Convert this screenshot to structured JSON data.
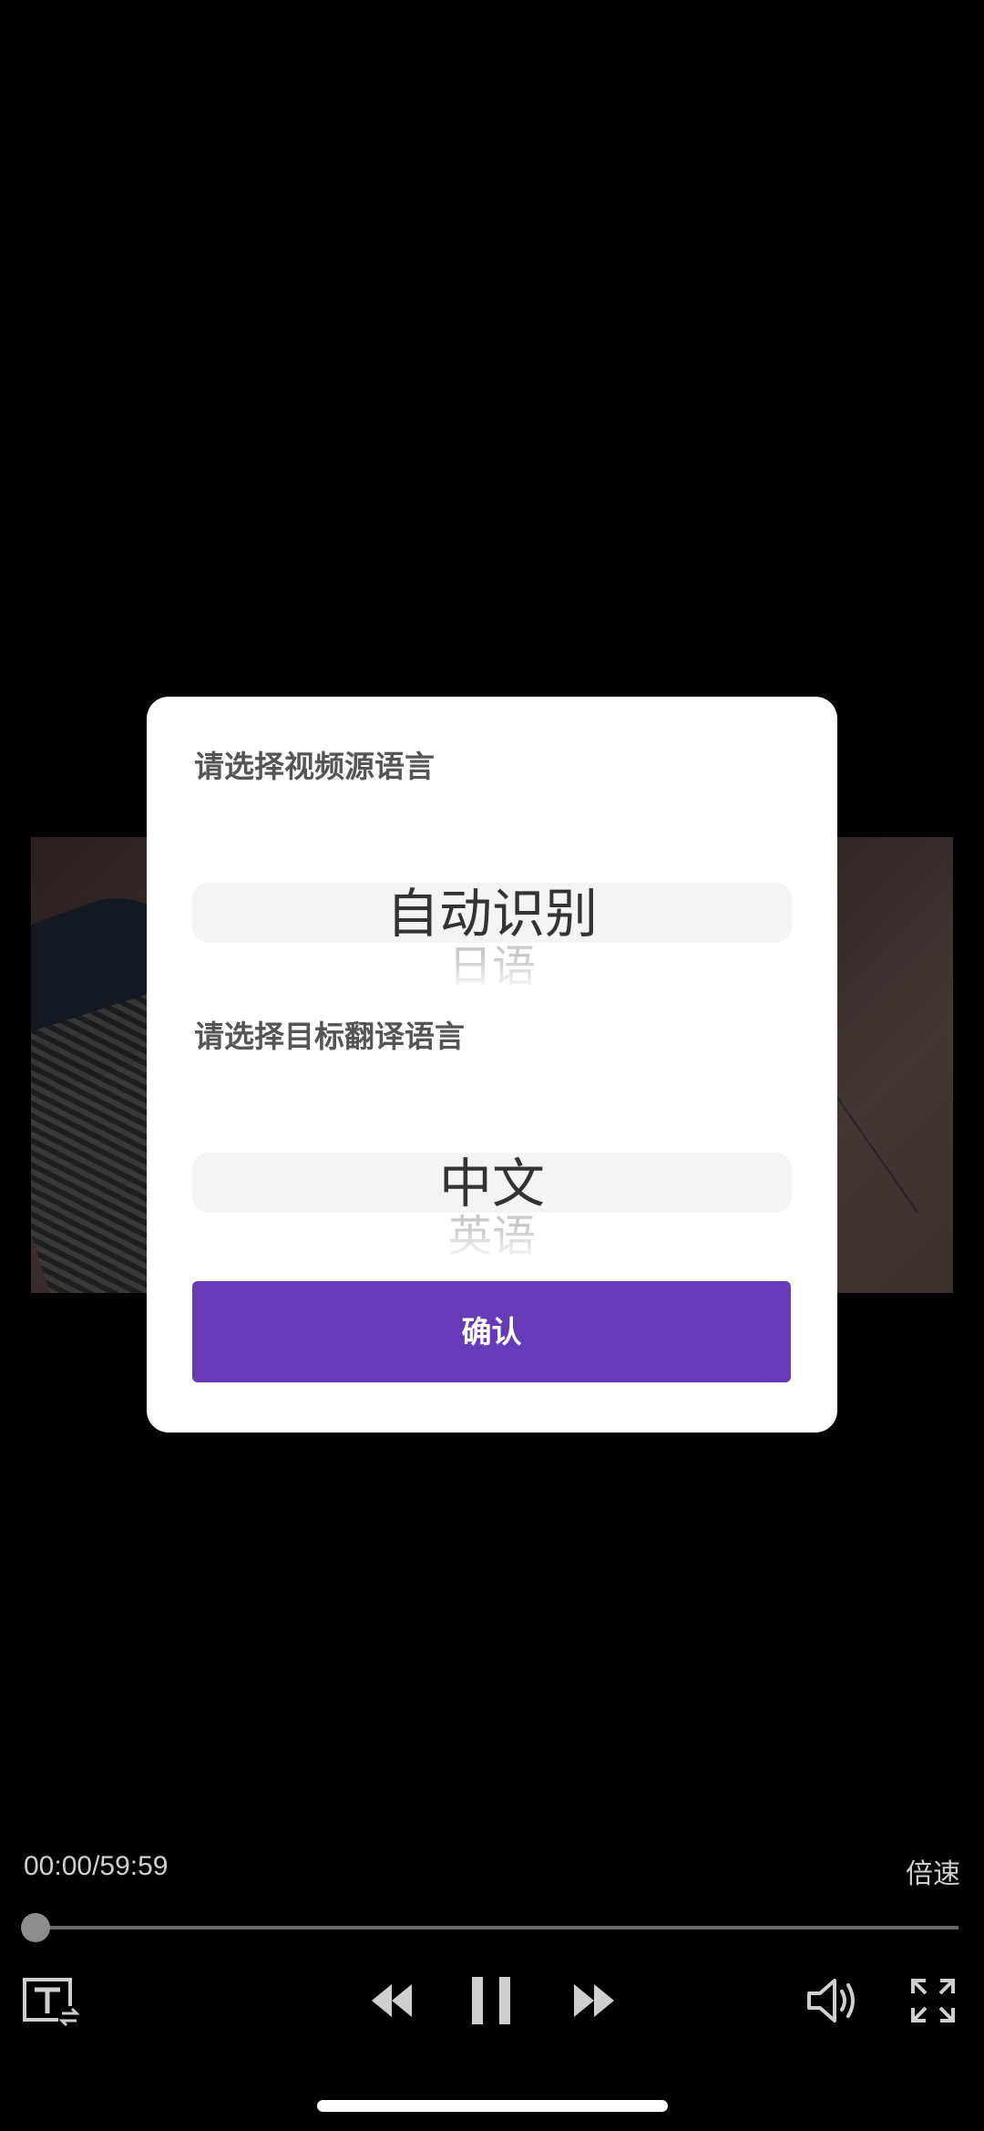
{
  "dialog": {
    "source_title": "请选择视频源语言",
    "source_picker": {
      "selected": "自动识别",
      "next": "日语"
    },
    "target_title": "请选择目标翻译语言",
    "target_picker": {
      "selected": "中文",
      "next": "英语"
    },
    "confirm_label": "确认"
  },
  "player": {
    "time": "00:00/59:59",
    "speed_label": "倍速",
    "progress": 0
  },
  "colors": {
    "accent": "#673ab7",
    "background": "#000000"
  },
  "icons": [
    "subtitle-translate-icon",
    "rewind-icon",
    "pause-icon",
    "fast-forward-icon",
    "volume-icon",
    "fullscreen-icon"
  ]
}
